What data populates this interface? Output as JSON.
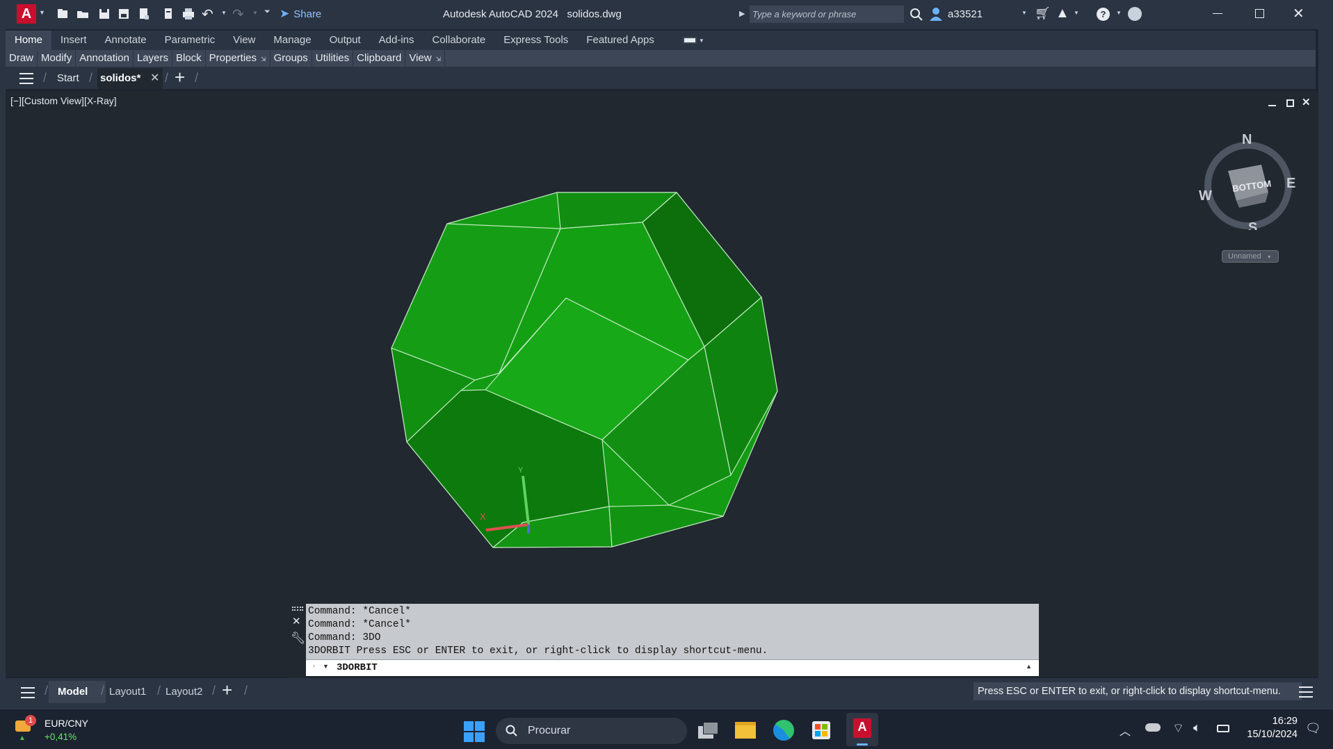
{
  "app": {
    "title": "Autodesk AutoCAD 2024",
    "filename": "solidos.dwg",
    "share_label": "Share",
    "search_placeholder": "Type a keyword or phrase",
    "username": "a33521"
  },
  "ribbon": {
    "tabs": [
      "Home",
      "Insert",
      "Annotate",
      "Parametric",
      "View",
      "Manage",
      "Output",
      "Add-ins",
      "Collaborate",
      "Express Tools",
      "Featured Apps"
    ],
    "active_tab": "Home",
    "panels": [
      "Draw",
      "Modify",
      "Annotation",
      "Layers",
      "Block",
      "Properties",
      "Groups",
      "Utilities",
      "Clipboard",
      "View"
    ]
  },
  "doc_tabs": {
    "start": "Start",
    "active_doc": "solidos*"
  },
  "viewport": {
    "label": "[−][Custom View][X-Ray]",
    "viewcube": {
      "face": "BOTTOM",
      "north": "N",
      "south": "S",
      "east": "E",
      "west": "W",
      "ucs_menu": "Unnamed"
    }
  },
  "command": {
    "history": [
      "Command: *Cancel*",
      "Command: *Cancel*",
      "Command: 3DO",
      "3DORBIT Press ESC or ENTER to exit, or right-click to display shortcut-menu."
    ],
    "current": "3DORBIT"
  },
  "layout_tabs": [
    "Model",
    "Layout1",
    "Layout2"
  ],
  "status": {
    "message": "Press ESC or ENTER to exit, or right-click to display shortcut-menu."
  },
  "taskbar": {
    "widget_title": "EUR/CNY",
    "widget_value": "+0,41%",
    "widget_badge": "1",
    "search_label": "Procurar",
    "time": "16:29",
    "date": "15/10/2024"
  },
  "colors": {
    "accent_red": "#c8102e",
    "solid_green": "#14a514",
    "viewport_bg": "#212830"
  }
}
